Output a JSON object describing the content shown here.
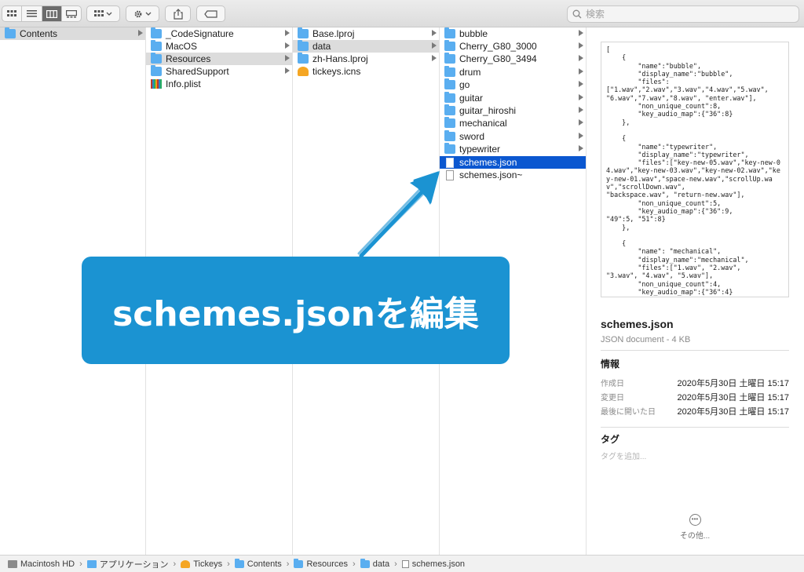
{
  "toolbar": {
    "view_icons": [
      "icon-view-icon",
      "list-view-icon",
      "column-view-icon",
      "gallery-view-icon"
    ],
    "active_view": "column",
    "search_placeholder": "検索"
  },
  "columns": [
    {
      "items": [
        {
          "name": "Contents",
          "kind": "folder",
          "selected": "gray",
          "has_children": true
        }
      ]
    },
    {
      "items": [
        {
          "name": "_CodeSignature",
          "kind": "folder",
          "has_children": true
        },
        {
          "name": "MacOS",
          "kind": "folder",
          "has_children": true
        },
        {
          "name": "Resources",
          "kind": "folder",
          "selected": "gray",
          "has_children": true
        },
        {
          "name": "SharedSupport",
          "kind": "folder",
          "has_children": true
        },
        {
          "name": "Info.plist",
          "kind": "plist",
          "has_children": false
        }
      ]
    },
    {
      "items": [
        {
          "name": "Base.lproj",
          "kind": "folder",
          "has_children": true
        },
        {
          "name": "data",
          "kind": "folder",
          "selected": "gray",
          "has_children": true
        },
        {
          "name": "zh-Hans.lproj",
          "kind": "folder",
          "has_children": true
        },
        {
          "name": "tickeys.icns",
          "kind": "icns",
          "has_children": false
        }
      ]
    },
    {
      "items": [
        {
          "name": "bubble",
          "kind": "folder",
          "has_children": true
        },
        {
          "name": "Cherry_G80_3000",
          "kind": "folder",
          "has_children": true
        },
        {
          "name": "Cherry_G80_3494",
          "kind": "folder",
          "has_children": true
        },
        {
          "name": "drum",
          "kind": "folder",
          "has_children": true
        },
        {
          "name": "go",
          "kind": "folder",
          "has_children": true
        },
        {
          "name": "guitar",
          "kind": "folder",
          "has_children": true
        },
        {
          "name": "guitar_hiroshi",
          "kind": "folder",
          "has_children": true
        },
        {
          "name": "mechanical",
          "kind": "folder",
          "has_children": true
        },
        {
          "name": "sword",
          "kind": "folder",
          "has_children": true
        },
        {
          "name": "typewriter",
          "kind": "folder",
          "has_children": true
        },
        {
          "name": "schemes.json",
          "kind": "doc",
          "selected": "blue",
          "has_children": false
        },
        {
          "name": "schemes.json~",
          "kind": "doc",
          "has_children": false
        }
      ]
    }
  ],
  "preview": {
    "json_text": "[\n    {\n        \"name\":\"bubble\",\n        \"display_name\":\"bubble\",\n        \"files\":\n[\"1.wav\",\"2.wav\",\"3.wav\",\"4.wav\",\"5.wav\",\n\"6.wav\",\"7.wav\",\"8.wav\", \"enter.wav\"],\n        \"non_unique_count\":8,\n        \"key_audio_map\":{\"36\":8}\n    },\n\n    {\n        \"name\":\"typewriter\",\n        \"display_name\":\"typewriter\",\n        \"files\":[\"key-new-05.wav\",\"key-new-04.wav\",\"key-new-03.wav\",\"key-new-02.wav\",\"key-new-01.wav\",\"space-new.wav\",\"scrollUp.wav\",\"scrollDown.wav\",\n\"backspace.wav\", \"return-new.wav\"],\n        \"non_unique_count\":5,\n        \"key_audio_map\":{\"36\":9,\n\"49\":5, \"51\":8}\n    },\n\n    {\n        \"name\": \"mechanical\",\n        \"display_name\":\"mechanical\",\n        \"files\":[\"1.wav\", \"2.wav\",\n\"3.wav\", \"4.wav\", \"5.wav\"],\n        \"non_unique_count\":4,\n        \"key_audio_map\":{\"36\":4}\n    },",
    "file_name": "schemes.json",
    "file_kind": "JSON document - 4 KB",
    "info_heading": "情報",
    "info": [
      {
        "label": "作成日",
        "value": "2020年5月30日 土曜日 15:17"
      },
      {
        "label": "変更日",
        "value": "2020年5月30日 土曜日 15:17"
      },
      {
        "label": "最後に開いた日",
        "value": "2020年5月30日 土曜日 15:17"
      }
    ],
    "tags_heading": "タグ",
    "tags_placeholder": "タグを追加...",
    "more_label": "その他..."
  },
  "pathbar": [
    {
      "label": "Macintosh HD",
      "icon": "hard-drive-icon"
    },
    {
      "label": "アプリケーション",
      "icon": "applications-folder-icon"
    },
    {
      "label": "Tickeys",
      "icon": "app-icon"
    },
    {
      "label": "Contents",
      "icon": "folder-icon"
    },
    {
      "label": "Resources",
      "icon": "folder-icon"
    },
    {
      "label": "data",
      "icon": "folder-icon"
    },
    {
      "label": "schemes.json",
      "icon": "json-file-icon"
    }
  ],
  "annotation": {
    "banner_text": "schemes.jsonを編集",
    "banner_color": "#1b93d2",
    "selection_color": "#0b57d0"
  }
}
